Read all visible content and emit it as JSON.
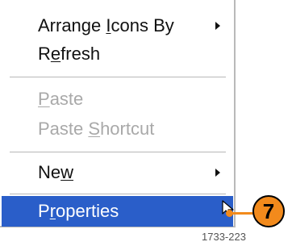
{
  "context_menu": {
    "arrange": {
      "pre": "Arrange ",
      "acc": "I",
      "post": "cons By"
    },
    "refresh": {
      "pre": "R",
      "acc": "e",
      "post": "fresh"
    },
    "paste": {
      "pre": "",
      "acc": "P",
      "post": "aste"
    },
    "paste_shortcut": {
      "pre": "Paste ",
      "acc": "S",
      "post": "hortcut"
    },
    "new": {
      "pre": "Ne",
      "acc": "w",
      "post": ""
    },
    "properties": {
      "pre": "P",
      "acc": "r",
      "post": "operties"
    }
  },
  "callout": {
    "number": "7"
  },
  "figure_id": "1733-223",
  "colors": {
    "selection": "#2a5ec9",
    "callout": "#f28a1c",
    "disabled_text": "#a9a9a9"
  },
  "icons": {
    "submenu": "triangle-right",
    "cursor": "mouse-pointer-arrow"
  }
}
